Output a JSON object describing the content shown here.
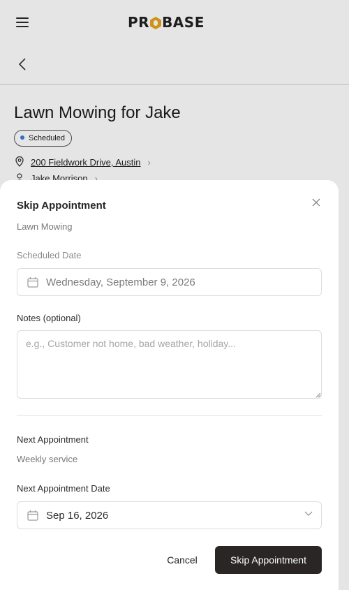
{
  "header": {
    "logo_text_a": "PR",
    "logo_text_b": "BASE",
    "menu_icon": "hamburger-icon",
    "back_icon": "chevron-left-icon"
  },
  "job": {
    "title": "Lawn Mowing for Jake",
    "status": "Scheduled",
    "address": "200 Fieldwork Drive, Austin",
    "customer": "Jake Morrison",
    "status_color": "#3a7bd5"
  },
  "modal": {
    "title": "Skip Appointment",
    "subtitle": "Lawn Mowing",
    "scheduled_label": "Scheduled Date",
    "scheduled_value": "Wednesday, September 9, 2026",
    "notes_label": "Notes (optional)",
    "notes_placeholder": "e.g., Customer not home, bad weather, holiday...",
    "notes_value": "",
    "next_label": "Next Appointment",
    "next_sub": "Weekly service",
    "next_date_label": "Next Appointment Date",
    "next_date_value": "Sep 16, 2026",
    "cancel_label": "Cancel",
    "skip_label": "Skip Appointment",
    "accent": "#2a2625"
  }
}
